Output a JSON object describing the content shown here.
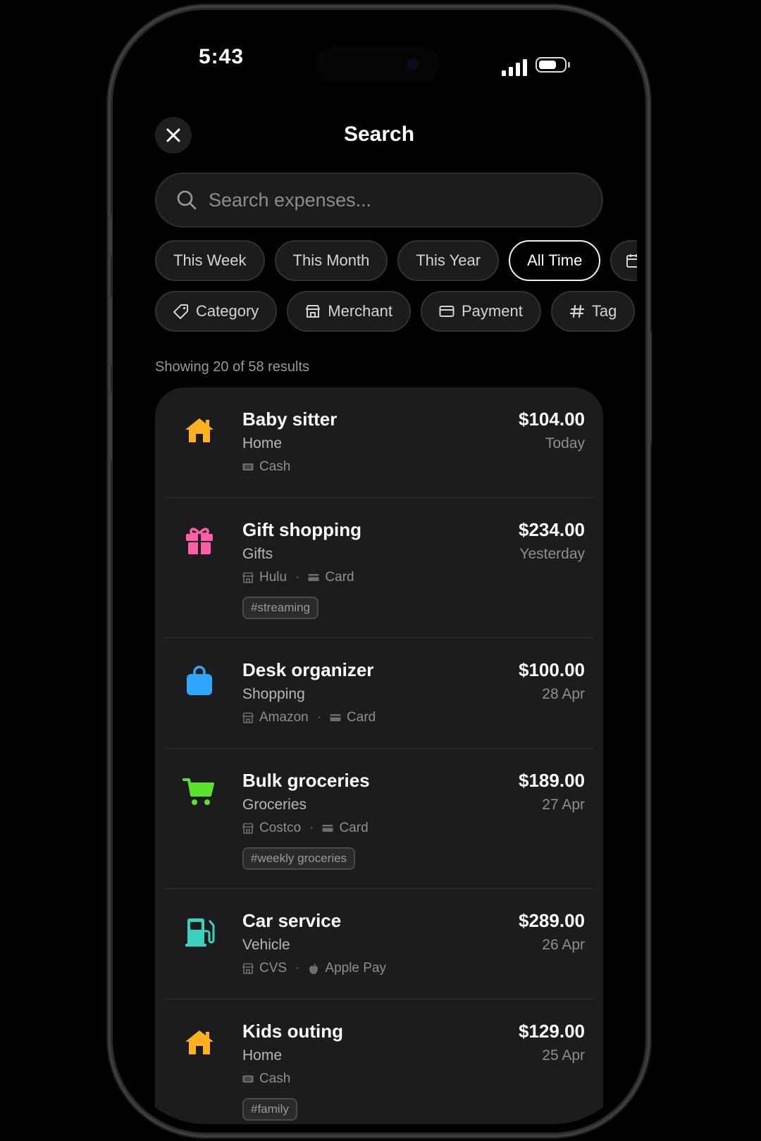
{
  "status_bar": {
    "time": "5:43"
  },
  "header": {
    "title": "Search"
  },
  "search": {
    "placeholder": "Search expenses..."
  },
  "time_filters": [
    "This Week",
    "This Month",
    "This Year",
    "All Time"
  ],
  "active_time_filter": "All Time",
  "attribute_filters": [
    {
      "label": "Category",
      "icon": "tag-icon"
    },
    {
      "label": "Merchant",
      "icon": "store-icon"
    },
    {
      "label": "Payment",
      "icon": "card-icon"
    },
    {
      "label": "Tag",
      "icon": "hash-icon"
    }
  ],
  "results_text": "Showing 20 of 58 results",
  "colors": {
    "home": "#FFB11E",
    "gifts": "#FF5FA8",
    "shopping": "#2EA8FF",
    "groceries": "#5BE32B",
    "vehicle": "#3FD1C0"
  },
  "expenses": [
    {
      "title": "Baby sitter",
      "category": "Home",
      "amount": "$104.00",
      "date": "Today",
      "merchant": "",
      "payment": "Cash",
      "tag": ""
    },
    {
      "title": "Gift shopping",
      "category": "Gifts",
      "amount": "$234.00",
      "date": "Yesterday",
      "merchant": "Hulu",
      "payment": "Card",
      "tag": "#streaming"
    },
    {
      "title": "Desk organizer",
      "category": "Shopping",
      "amount": "$100.00",
      "date": "28 Apr",
      "merchant": "Amazon",
      "payment": "Card",
      "tag": ""
    },
    {
      "title": "Bulk groceries",
      "category": "Groceries",
      "amount": "$189.00",
      "date": "27 Apr",
      "merchant": "Costco",
      "payment": "Card",
      "tag": "#weekly groceries"
    },
    {
      "title": "Car service",
      "category": "Vehicle",
      "amount": "$289.00",
      "date": "26 Apr",
      "merchant": "CVS",
      "payment": "Apple Pay",
      "tag": ""
    },
    {
      "title": "Kids outing",
      "category": "Home",
      "amount": "$129.00",
      "date": "25 Apr",
      "merchant": "",
      "payment": "Cash",
      "tag": "#family"
    }
  ]
}
